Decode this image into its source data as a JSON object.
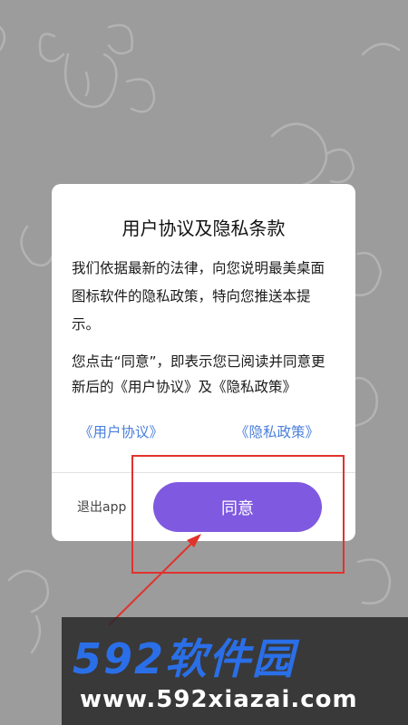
{
  "dialog": {
    "title": "用户协议及隐私条款",
    "paragraph1": "我们依据最新的法律，向您说明最美桌面图标软件的隐私政策，特向您推送本提示。",
    "paragraph2": "您点击“同意”，即表示您已阅读并同意更新后的《用户协议》及《隐私政策》",
    "link_user_agreement": "《用户协议》",
    "link_privacy_policy": "《隐私政策》",
    "exit_label": "退出app",
    "agree_label": "同意"
  },
  "watermark": {
    "logo": "592软件园",
    "url": "www.592xiazai.com"
  },
  "colors": {
    "accent": "#7f5ae0",
    "link": "#4a7fdb",
    "highlight": "#e0332c",
    "watermark_blue": "#2a6fe8"
  }
}
